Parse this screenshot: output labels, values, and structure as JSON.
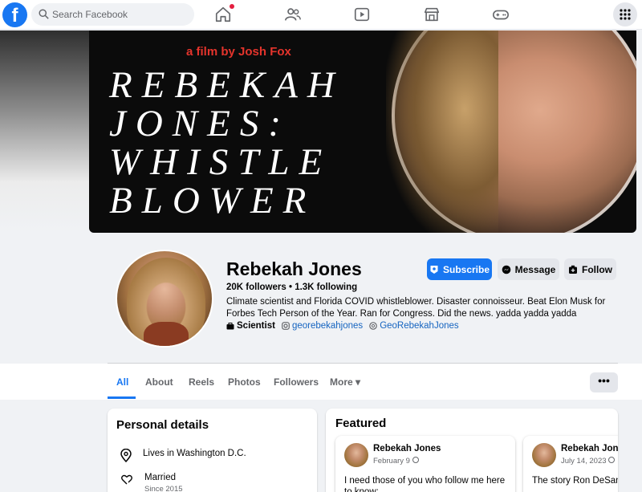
{
  "nav": {
    "logo": "f",
    "search_placeholder": "Search Facebook",
    "icons": [
      "home-icon",
      "friends-icon",
      "video-icon",
      "marketplace-icon",
      "gaming-icon",
      "menu-grid-icon"
    ],
    "accent": "#1877f2",
    "notification_color": "#e41e3f"
  },
  "cover": {
    "tagline": "a film by Josh Fox",
    "title_lines": [
      "REBEKAH",
      "JONES:",
      "WHISTLE",
      "BLOWER"
    ],
    "tag_color": "#e4342c"
  },
  "profile": {
    "name": "Rebekah Jones",
    "counts": "20K followers • 1.3K following",
    "bio": "Climate scientist and Florida COVID whistleblower. Disaster connoisseur. Beat Elon Musk for Forbes Tech Person of the Year. Ran for Congress. Did the news. yadda yadda yadda",
    "category": "Scientist",
    "instagram": "georebekahjones",
    "threads": "GeoRebekahJones"
  },
  "actions": {
    "subscribe": "Subscribe",
    "message": "Message",
    "follow": "Follow"
  },
  "tabs": {
    "items": [
      "All",
      "About",
      "Reels",
      "Photos",
      "Followers",
      "More ▾"
    ],
    "more_options": "•••"
  },
  "personal": {
    "heading": "Personal details",
    "location": "Lives in Washington D.C.",
    "relationship": "Married",
    "relationship_since": "Since 2015"
  },
  "featured": {
    "heading": "Featured",
    "posts": [
      {
        "author": "Rebekah Jones",
        "date": "February 9",
        "text": "I need those of you who follow me here to know:"
      },
      {
        "author": "Rebekah Jones",
        "date": "July 14, 2023",
        "text": "The story Ron DeSantis read:"
      }
    ]
  }
}
